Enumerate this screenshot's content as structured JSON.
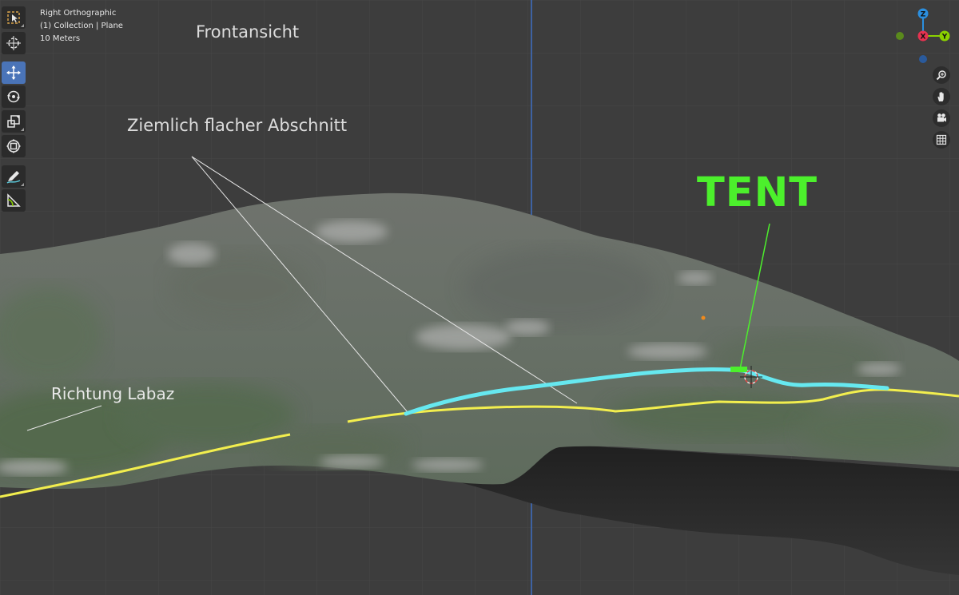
{
  "viewport": {
    "info": {
      "view_name": "Right Orthographic",
      "collection": "(1) Collection | Plane",
      "scale": "10 Meters"
    },
    "title_annotation": "Frontansicht",
    "annotations": {
      "flat_section": "Ziemlich flacher Abschnitt",
      "direction": "Richtung Labaz",
      "tent": "TENT"
    }
  },
  "gizmo": {
    "z_label": "Z",
    "y_label": "Y",
    "x_label": "X",
    "colors": {
      "x": "#e53250",
      "y": "#8bd100",
      "z": "#2b8fdf",
      "neg_x": "#7a2535",
      "neg_y": "#5a8a1c",
      "neg_z": "#2a5a9c"
    }
  },
  "toolbar": {
    "tools": [
      {
        "name": "select-box",
        "icon": "select-box-icon"
      },
      {
        "name": "cursor",
        "icon": "cursor-icon"
      },
      {
        "name": "move",
        "icon": "move-icon",
        "active": true
      },
      {
        "name": "rotate",
        "icon": "rotate-icon"
      },
      {
        "name": "scale",
        "icon": "scale-icon"
      },
      {
        "name": "transform",
        "icon": "transform-icon"
      },
      {
        "name": "annotate",
        "icon": "annotate-icon"
      },
      {
        "name": "measure",
        "icon": "measure-icon"
      }
    ]
  },
  "navigation": [
    "zoom-icon",
    "hand-pan-icon",
    "camera-icon",
    "grid-icon"
  ],
  "colors": {
    "background": "#3d3d3d",
    "grid": "#4a4a4a",
    "terrain": "#6c716a",
    "terrain_shadow": "#272727",
    "path_yellow": "#f2ee4e",
    "path_cyan": "#66e8f0",
    "tent_green": "#4cf02c",
    "axis_blue": "#3f6ec4"
  }
}
